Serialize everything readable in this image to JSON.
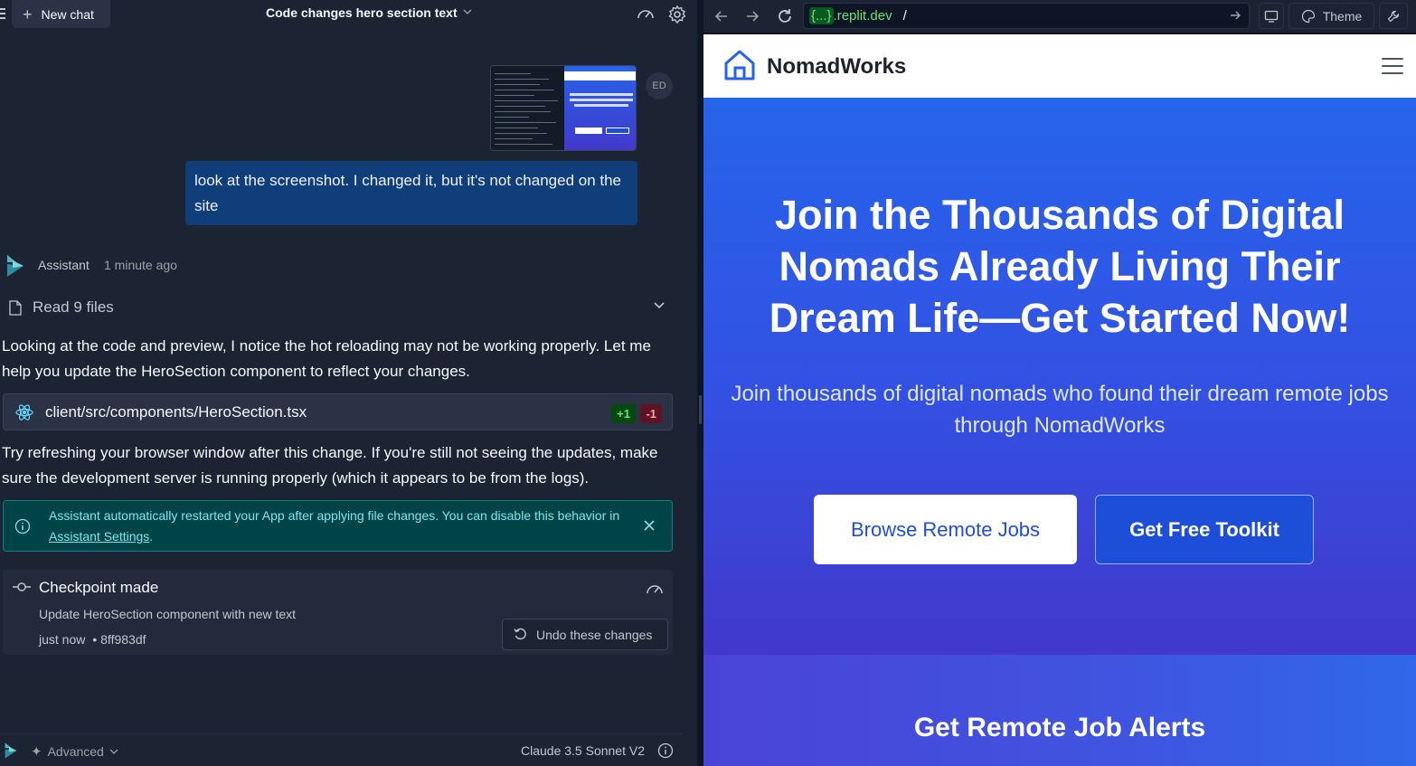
{
  "chat": {
    "new_chat_label": "New chat",
    "title": "Code changes hero section text",
    "user_avatar_initials": "ED",
    "user_message": "look at the screenshot. I changed it, but it's not changed on the site",
    "assistant_name": "Assistant",
    "assistant_time": "1 minute ago",
    "read_files_label": "Read 9 files",
    "paragraph_1": "Looking at the code and preview, I notice the hot reloading may not be working properly. Let me help you update the HeroSection component to reflect your changes.",
    "file_path": "client/src/components/HeroSection.tsx",
    "additions": "+1",
    "deletions": "-1",
    "paragraph_2": "Try refreshing your browser window after this change. If you're still not seeing the updates, make sure the development server is running properly (which it appears to be from the logs).",
    "notice_text": "Assistant automatically restarted your App after applying file changes. You can disable this behavior in ",
    "notice_link": "Assistant Settings",
    "notice_end": ".",
    "checkpoint_title": "Checkpoint made",
    "checkpoint_desc": "Update HeroSection component with new text",
    "checkpoint_time": "just now",
    "checkpoint_hash": "• 8ff983df",
    "undo_label": "Undo these changes",
    "advanced_label": "Advanced",
    "model_label": "Claude 3.5 Sonnet V2"
  },
  "browser": {
    "url_braces": "{...}",
    "url_domain": ".replit.dev",
    "url_path": "/",
    "theme_label": "Theme"
  },
  "site": {
    "brand": "NomadWorks",
    "hero_title": "Join the Thousands of Digital Nomads Already Living Their Dream Life—Get Started Now!",
    "hero_subtitle": "Join thousands of digital nomads who found their dream remote jobs through NomadWorks",
    "browse_button": "Browse Remote Jobs",
    "toolkit_button": "Get Free Toolkit",
    "alerts_heading": "Get Remote Job Alerts"
  },
  "colors": {
    "chat_bg": "#1c2333",
    "user_bubble": "#0f3e7a",
    "notice_bg": "#004448",
    "hero_blue": "#2664ea",
    "hero_indigo": "#4338ca",
    "cta_blue": "#1d4ed8"
  }
}
